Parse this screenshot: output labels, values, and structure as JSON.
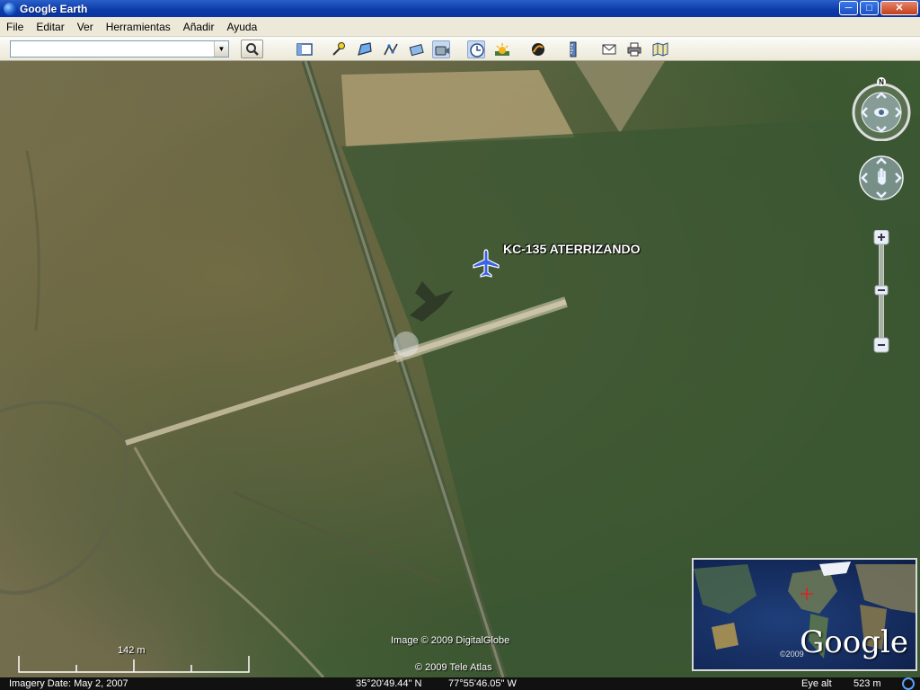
{
  "window": {
    "title": "Google Earth",
    "controls": {
      "minimize": "─",
      "maximize": "□",
      "close": "✕"
    }
  },
  "menu": {
    "items": [
      "File",
      "Editar",
      "Ver",
      "Herramientas",
      "Añadir",
      "Ayuda"
    ]
  },
  "toolbar": {
    "search_value": "",
    "search_icon": "magnifier-icon",
    "icons": [
      "sidebar-toggle-icon",
      "add-placemark-icon",
      "add-polygon-icon",
      "add-path-icon",
      "add-overlay-icon",
      "record-tour-icon",
      "historical-imagery-icon",
      "sunlight-icon",
      "sky-switch-icon",
      "ruler-icon",
      "email-icon",
      "print-icon",
      "view-in-maps-icon"
    ]
  },
  "map": {
    "placemark": {
      "label": "KC-135 ATERRIZANDO",
      "icon": "airplane-icon",
      "color": "#3a63e6"
    },
    "compass_north": "N",
    "scale_label": "142 m",
    "credit_image": "Image © 2009 DigitalGlobe",
    "credit_atlas": "© 2009 Tele Atlas",
    "overview": {
      "brand": "Google",
      "copyright": "©2009"
    }
  },
  "status": {
    "imagery_date": "Imagery Date: May  2, 2007",
    "latitude": "35°20'49.44\" N",
    "longitude": "77°55'46.05\" W",
    "eye_alt_label": "Eye alt",
    "eye_alt_value": "523 m"
  }
}
